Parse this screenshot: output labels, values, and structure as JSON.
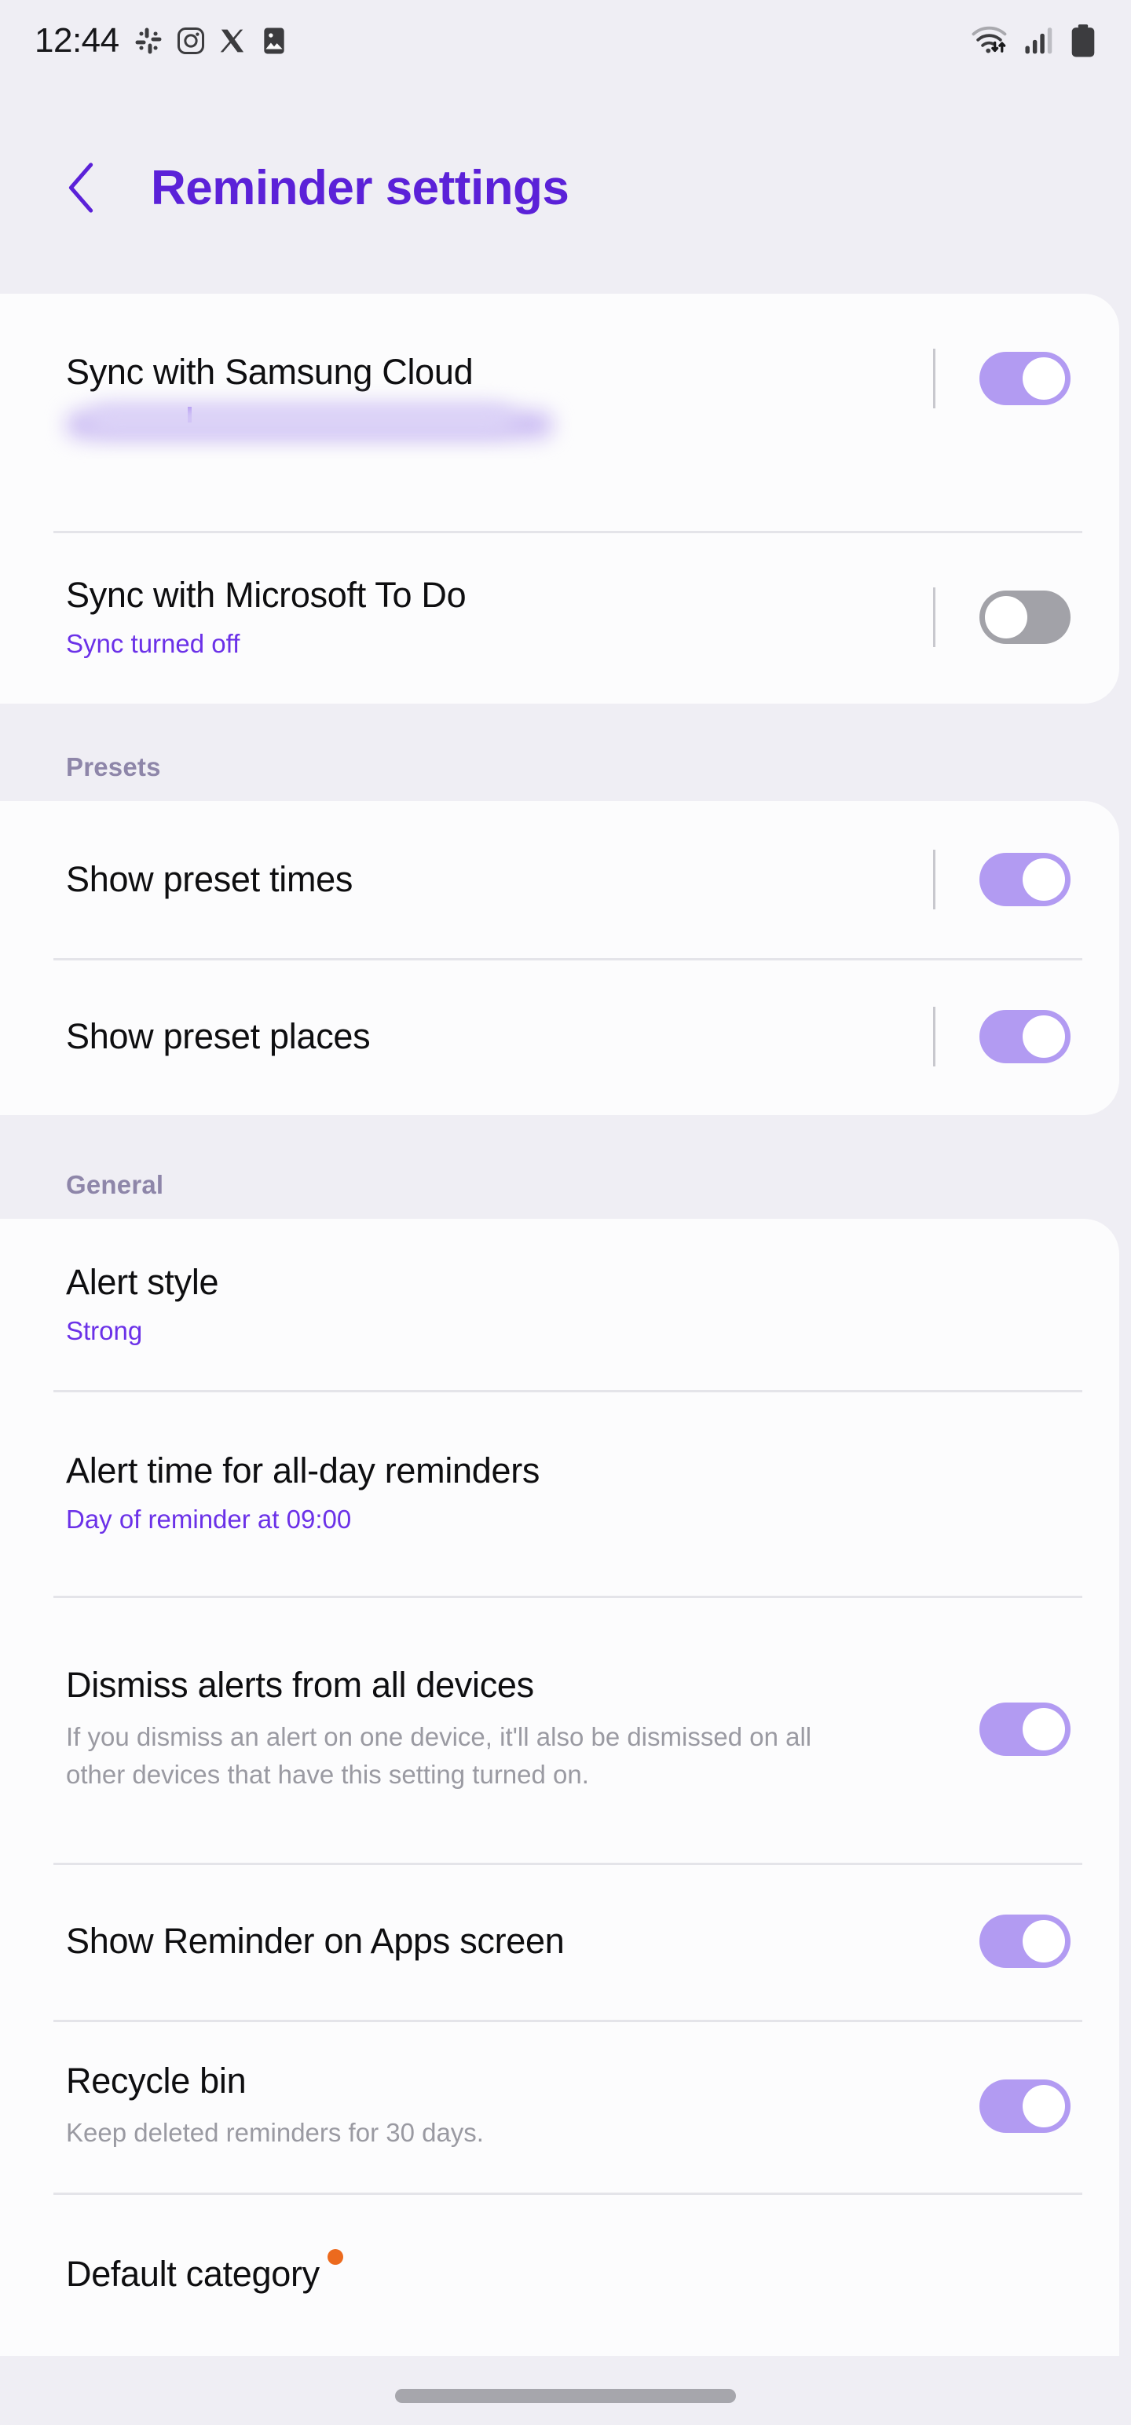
{
  "status_bar": {
    "time": "12:44",
    "left_icons": [
      "slack-icon",
      "instagram-icon",
      "x-twitter-icon",
      "gallery-icon"
    ],
    "right_icons": [
      "wifi-transfer-icon",
      "cellular-signal-icon",
      "battery-icon"
    ],
    "signal_bars_filled": 3,
    "signal_bars_total": 4,
    "battery_level": 100
  },
  "header": {
    "back_icon": "chevron-left-icon",
    "title": "Reminder settings",
    "accent_color": "#5B21D8"
  },
  "theme": {
    "background": "#EFEEF4",
    "card_background": "#FCFCFD",
    "toggle_on_color": "#B29BF2",
    "toggle_off_color": "#A2A2A8",
    "subtitle_color": "#6B31E8",
    "description_color": "#9A9AA2",
    "section_header_color": "#8E86A9",
    "badge_color": "#EC6A1E"
  },
  "sections": [
    {
      "header": null,
      "rows": [
        {
          "title": "Sync with Samsung Cloud",
          "subtitle_redacted": true,
          "toggle": "on",
          "has_separator": true
        },
        {
          "title": "Sync with Microsoft To Do",
          "subtitle": "Sync turned off",
          "toggle": "off",
          "has_separator": true
        }
      ]
    },
    {
      "header": "Presets",
      "rows": [
        {
          "title": "Show preset times",
          "toggle": "on",
          "has_separator": true
        },
        {
          "title": "Show preset places",
          "toggle": "on",
          "has_separator": true
        }
      ]
    },
    {
      "header": "General",
      "rows": [
        {
          "title": "Alert style",
          "subtitle": "Strong",
          "toggle": null
        },
        {
          "title": "Alert time for all-day reminders",
          "subtitle": "Day of reminder at 09:00",
          "toggle": null
        },
        {
          "title": "Dismiss alerts from all devices",
          "description": "If you dismiss an alert on one device, it'll also be dismissed on all other devices that have this setting turned on.",
          "toggle": "on",
          "has_separator": false
        },
        {
          "title": "Show Reminder on Apps screen",
          "toggle": "on",
          "has_separator": false
        },
        {
          "title": "Recycle bin",
          "description": "Keep deleted reminders for 30 days.",
          "toggle": "on",
          "has_separator": false
        },
        {
          "title": "Default category",
          "badge": "new-dot",
          "toggle": null
        }
      ]
    }
  ]
}
